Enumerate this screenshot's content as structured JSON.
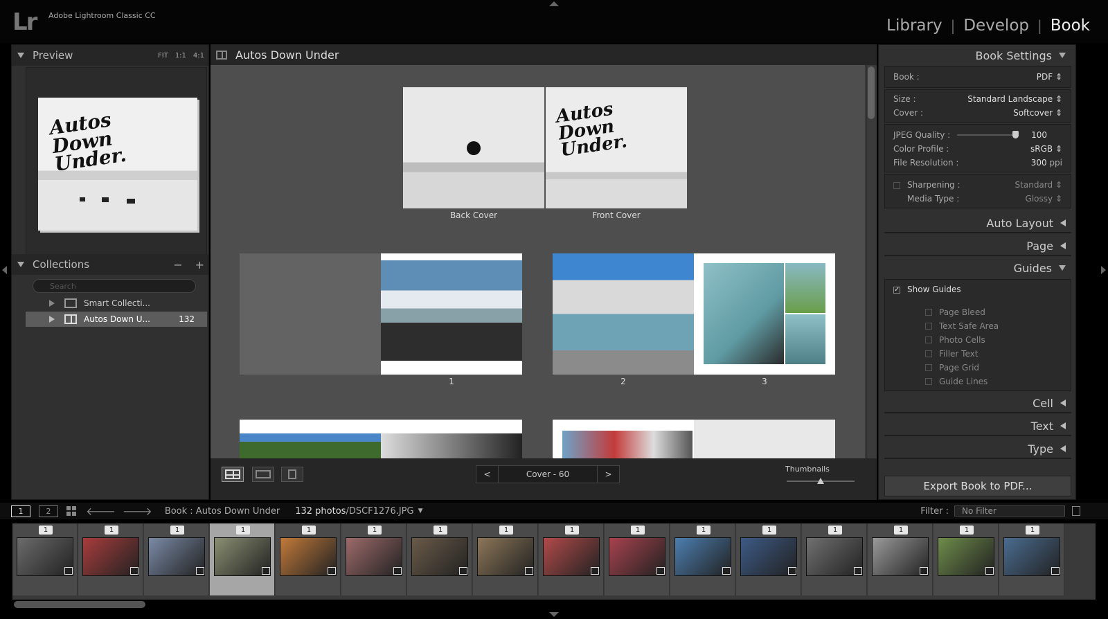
{
  "app": {
    "logo": "Lr",
    "title": "Adobe Lightroom Classic CC"
  },
  "modules": [
    {
      "label": "Library"
    },
    {
      "label": "Develop"
    },
    {
      "label": "Book",
      "active": true
    }
  ],
  "left": {
    "preview": {
      "title": "Preview",
      "zoom": [
        "FIT",
        "1:1",
        "4:1"
      ],
      "book_title_lines": [
        "Autos",
        "Down",
        "Under."
      ]
    },
    "collections": {
      "title": "Collections",
      "minus": "−",
      "plus": "+",
      "search_placeholder": "Search",
      "items": [
        {
          "name": "Smart Collecti...",
          "count": ""
        },
        {
          "name": "Autos Down U...",
          "count": "132"
        }
      ]
    }
  },
  "center": {
    "title": "Autos Down Under",
    "labels": {
      "back_cover": "Back Cover",
      "front_cover": "Front Cover",
      "p1": "1",
      "p2": "2",
      "p3": "3"
    },
    "pager": {
      "prev": "<",
      "text": "Cover - 60",
      "next": ">"
    },
    "thumbnails_label": "Thumbnails",
    "thumbnail_slider_fraction": 0.5
  },
  "right": {
    "book_settings": {
      "title": "Book Settings",
      "book_label": "Book :",
      "book_value": "PDF",
      "size_label": "Size :",
      "size_value": "Standard Landscape",
      "cover_label": "Cover :",
      "cover_value": "Softcover",
      "jpeg_label": "JPEG Quality :",
      "jpeg_value": "100",
      "profile_label": "Color Profile :",
      "profile_value": "sRGB",
      "res_label": "File Resolution :",
      "res_value": "300",
      "res_unit": "ppi",
      "sharpen_label": "Sharpening :",
      "sharpen_value": "Standard",
      "media_label": "Media Type :",
      "media_value": "Glossy"
    },
    "sections": {
      "auto_layout": "Auto Layout",
      "page": "Page",
      "guides": "Guides",
      "cell": "Cell",
      "text": "Text",
      "type": "Type"
    },
    "guides": {
      "show_guides": "Show Guides",
      "items": [
        "Page Bleed",
        "Text Safe Area",
        "Photo Cells",
        "Filler Text",
        "Page Grid",
        "Guide Lines"
      ]
    },
    "export_label": "Export Book to PDF..."
  },
  "filmstrip": {
    "view1": "1",
    "view2": "2",
    "source_prefix": "Book : Autos Down Under",
    "count": "132 photos",
    "file": "/DSCF1276.JPG",
    "filter_label": "Filter :",
    "filter_value": "No Filter",
    "thumb_badge": "1",
    "thumb_colors": [
      "#6b6b6b",
      "#a83c3c",
      "#7a8aa6",
      "#8a8f72",
      "#c27a3a",
      "#9d6a6a",
      "#6a5a48",
      "#8c7658",
      "#b24a4a",
      "#a8424e",
      "#4c7eb0",
      "#3d5a86",
      "#707070",
      "#9a9a9a",
      "#6e8c4a",
      "#4a6c90"
    ]
  }
}
